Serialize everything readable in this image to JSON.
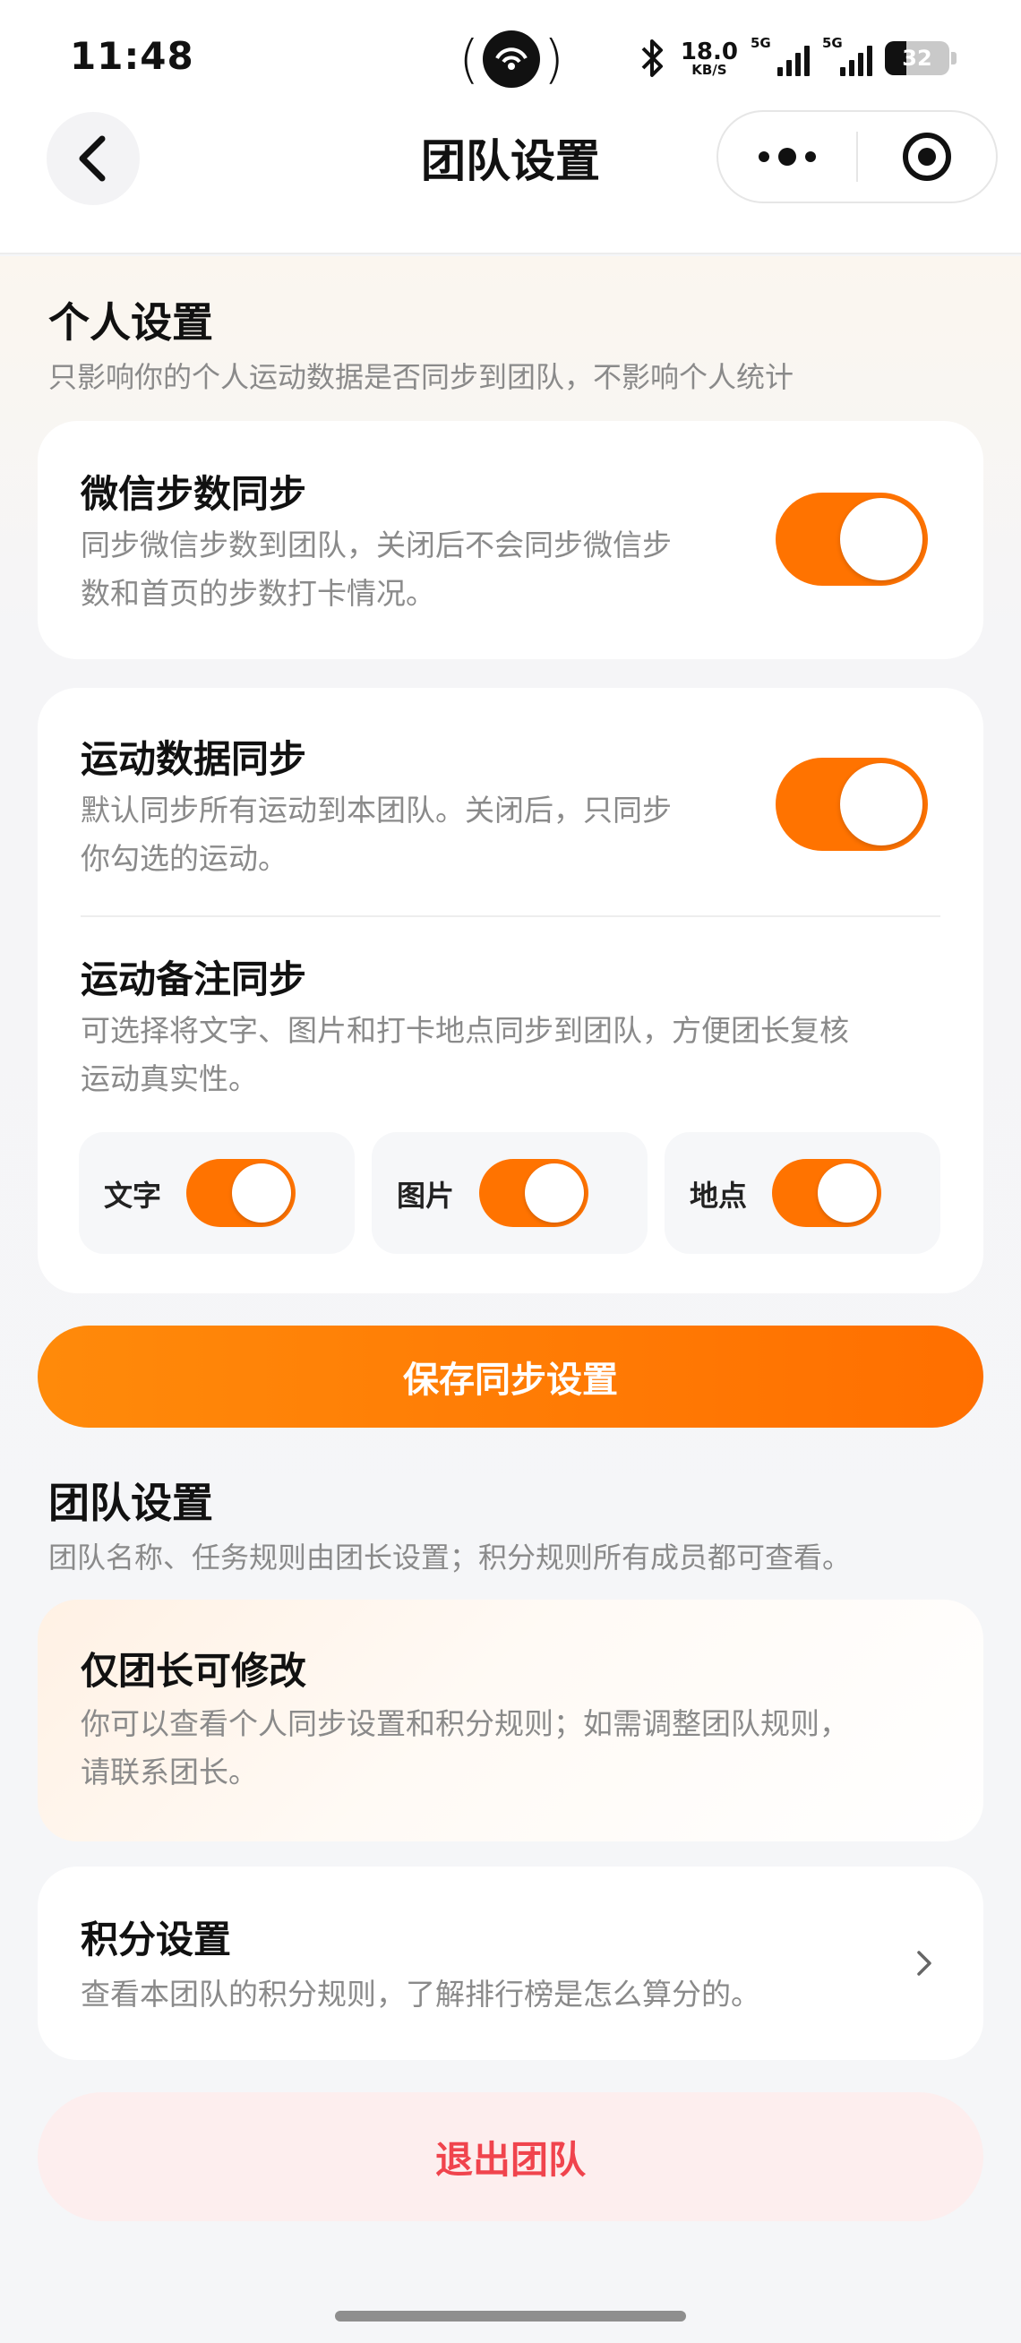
{
  "status_bar": {
    "time": "11:48",
    "net_speed_value": "18.0",
    "net_speed_unit": "KB/S",
    "signal1_tag": "5G",
    "signal2_tag": "5G",
    "battery": "32"
  },
  "nav": {
    "title": "团队设置"
  },
  "personal": {
    "title": "个人设置",
    "subtitle": "只影响你的个人运动数据是否同步到团队，不影响个人统计",
    "wechat_sync": {
      "title": "微信步数同步",
      "desc_line1": "同步微信步数到团队，关闭后不会同步微信步",
      "desc_line2": "数和首页的步数打卡情况。",
      "enabled": true
    },
    "sport_sync": {
      "title": "运动数据同步",
      "desc_line1": "默认同步所有运动到本团队。关闭后，只同步",
      "desc_line2": "你勾选的运动。",
      "enabled": true
    },
    "note_sync": {
      "title": "运动备注同步",
      "desc_line1": "可选择将文字、图片和打卡地点同步到团队，方便团长复核",
      "desc_line2": "运动真实性。",
      "options": [
        {
          "label": "文字",
          "enabled": true
        },
        {
          "label": "图片",
          "enabled": true
        },
        {
          "label": "地点",
          "enabled": true
        }
      ]
    },
    "save_label": "保存同步设置"
  },
  "team": {
    "title": "团队设置",
    "subtitle": "团队名称、任务规则由团长设置；积分规则所有成员都可查看。",
    "leader_only": {
      "title": "仅团长可修改",
      "desc_line1": "你可以查看个人同步设置和积分规则；如需调整团队规则，",
      "desc_line2": "请联系团长。"
    },
    "points": {
      "title": "积分设置",
      "desc": "查看本团队的积分规则，了解排行榜是怎么算分的。"
    },
    "quit_label": "退出团队"
  },
  "colors": {
    "accent": "#ff7300",
    "danger": "#f0444d"
  }
}
